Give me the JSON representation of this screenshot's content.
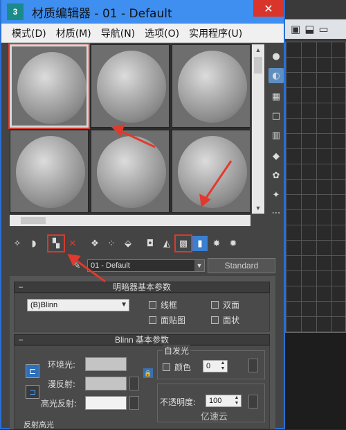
{
  "window": {
    "title": "材质编辑器 - 01 - Default",
    "app_icon": "3"
  },
  "menu": [
    {
      "label": "模式(D)"
    },
    {
      "label": "材质(M)"
    },
    {
      "label": "导航(N)"
    },
    {
      "label": "选项(O)"
    },
    {
      "label": "实用程序(U)"
    }
  ],
  "material": {
    "name": "01 - Default",
    "type_button": "Standard"
  },
  "shader_rollout": {
    "title": "明暗器基本参数",
    "shader": "(B)Blinn",
    "options": [
      {
        "label": "线框",
        "checked": false
      },
      {
        "label": "双面",
        "checked": false
      },
      {
        "label": "面贴图",
        "checked": false
      },
      {
        "label": "面状",
        "checked": false
      }
    ]
  },
  "blinn_rollout": {
    "title": "Blinn 基本参数",
    "ambient_label": "环境光:",
    "diffuse_label": "漫反射:",
    "specular_label": "高光反射:",
    "self_illum_group": "自发光",
    "color_label": "颜色",
    "color_value": "0",
    "opacity_label": "不透明度:",
    "opacity_value": "100",
    "next_section_partial": "反射高光"
  },
  "colors": {
    "ambient": "#c4c4c4",
    "diffuse": "#c4c4c4",
    "specular": "#f2f2f2",
    "highlight_red": "#d63a2e",
    "title_bar": "#3e8ff0"
  },
  "watermark": "亿速云"
}
